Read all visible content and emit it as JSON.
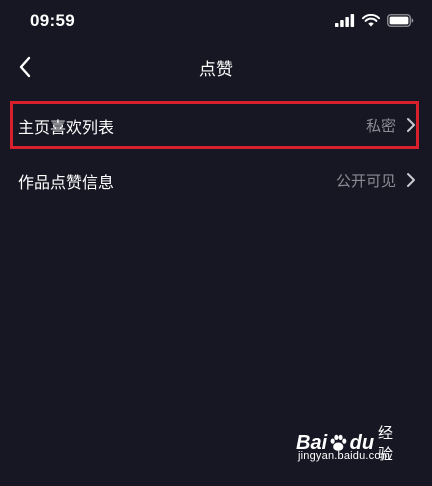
{
  "status_bar": {
    "time": "09:59",
    "icons": [
      "signal-icon",
      "wifi-icon",
      "battery-icon"
    ]
  },
  "header": {
    "back_icon": "chevron-left-icon",
    "title": "点赞"
  },
  "settings": [
    {
      "label": "主页喜欢列表",
      "value": "私密",
      "highlighted": true
    },
    {
      "label": "作品点赞信息",
      "value": "公开可见",
      "highlighted": false
    }
  ],
  "watermark": {
    "logo_left": "Bai",
    "logo_right": "du",
    "product": "经验",
    "url": "jingyan.baidu.com"
  },
  "colors": {
    "background": "#161722",
    "text_primary": "#ffffff",
    "text_secondary": "#8a8b93",
    "highlight_border": "#d8202d"
  }
}
